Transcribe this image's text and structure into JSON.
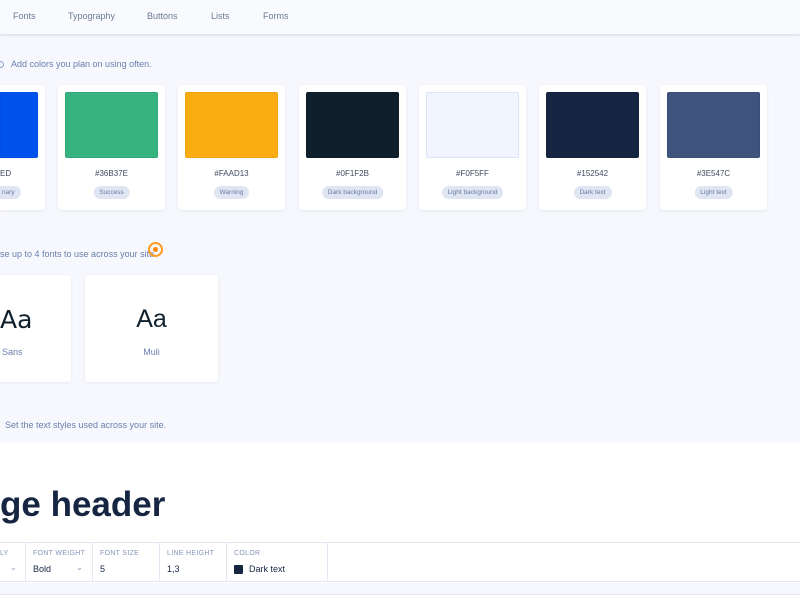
{
  "nav": {
    "items": [
      "Fonts",
      "Typography",
      "Buttons",
      "Lists",
      "Forms"
    ]
  },
  "colors": {
    "subtitle": "Add colors you plan on using often.",
    "swatches": [
      {
        "hex": "ED",
        "label": "nary",
        "color": "#0052ED"
      },
      {
        "hex": "#36B37E",
        "label": "Success",
        "color": "#36B37E"
      },
      {
        "hex": "#FAAD13",
        "label": "Warning",
        "color": "#FAAD13"
      },
      {
        "hex": "#0F1F2B",
        "label": "Dark background",
        "color": "#0F1F2B"
      },
      {
        "hex": "#F0F5FF",
        "label": "Light background",
        "color": "#F0F5FF"
      },
      {
        "hex": "#152542",
        "label": "Dark text",
        "color": "#152542"
      },
      {
        "hex": "#3E547C",
        "label": "Light text",
        "color": "#3E547C"
      }
    ]
  },
  "fonts": {
    "subtitle": "se up to 4 fonts to use across your site.",
    "items": [
      {
        "sample": "Aa",
        "name": "Sans"
      },
      {
        "sample": "Aa",
        "name": "Muli"
      }
    ]
  },
  "typography": {
    "subtitle": "Set the text styles used across your site.",
    "preview": "ge header",
    "props": [
      {
        "label": "LY",
        "value": ""
      },
      {
        "label": "FONT WEIGHT",
        "value": "Bold"
      },
      {
        "label": "FONT SIZE",
        "value": "5"
      },
      {
        "label": "LINE HEIGHT",
        "value": "1,3"
      },
      {
        "label": "COLOR",
        "value": "Dark text",
        "color": "#152542"
      }
    ]
  }
}
